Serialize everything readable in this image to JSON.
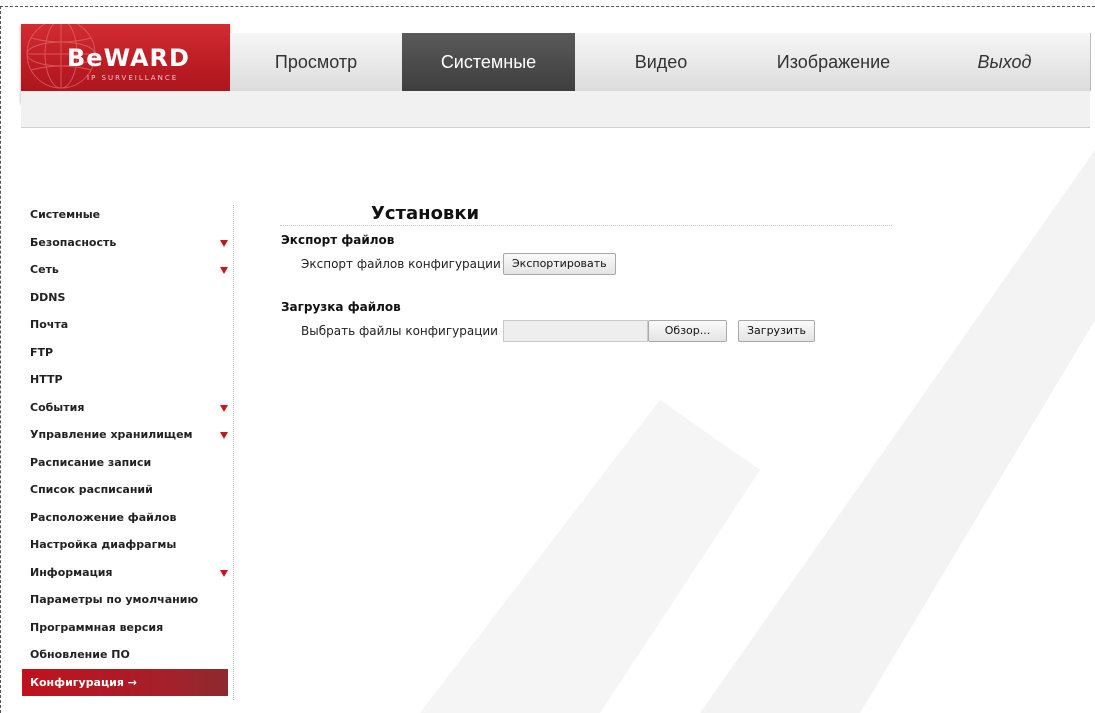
{
  "header": {
    "logo_text": "BeWARD",
    "logo_subtitle": "IP SURVEILLANCE",
    "tabs": [
      {
        "label": "Просмотр",
        "active": false,
        "italic": false
      },
      {
        "label": "Системные",
        "active": true,
        "italic": false
      },
      {
        "label": "Видео",
        "active": false,
        "italic": false
      },
      {
        "label": "Изображение",
        "active": false,
        "italic": false
      },
      {
        "label": "Выход",
        "active": false,
        "italic": true
      }
    ]
  },
  "sidebar": {
    "items": [
      {
        "label": "Системные",
        "has_submenu": false,
        "active": false
      },
      {
        "label": "Безопасность",
        "has_submenu": true,
        "active": false
      },
      {
        "label": "Сеть",
        "has_submenu": true,
        "active": false
      },
      {
        "label": "DDNS",
        "has_submenu": false,
        "active": false
      },
      {
        "label": "Почта",
        "has_submenu": false,
        "active": false
      },
      {
        "label": "FTP",
        "has_submenu": false,
        "active": false
      },
      {
        "label": "HTTP",
        "has_submenu": false,
        "active": false
      },
      {
        "label": "События",
        "has_submenu": true,
        "active": false
      },
      {
        "label": "Управление хранилищем",
        "has_submenu": true,
        "active": false
      },
      {
        "label": "Расписание записи",
        "has_submenu": false,
        "active": false
      },
      {
        "label": "Список расписаний",
        "has_submenu": false,
        "active": false
      },
      {
        "label": "Расположение файлов",
        "has_submenu": false,
        "active": false
      },
      {
        "label": "Настройка диафрагмы",
        "has_submenu": false,
        "active": false
      },
      {
        "label": "Информация",
        "has_submenu": true,
        "active": false
      },
      {
        "label": "Параметры по умолчанию",
        "has_submenu": false,
        "active": false
      },
      {
        "label": "Программная версия",
        "has_submenu": false,
        "active": false
      },
      {
        "label": "Обновление ПО",
        "has_submenu": false,
        "active": false
      },
      {
        "label": "Конфигурация →",
        "has_submenu": false,
        "active": true
      }
    ]
  },
  "main": {
    "title": "Установки",
    "export": {
      "section_title": "Экспорт файлов",
      "row_label": "Экспорт файлов конфигурации",
      "button_label": "Экспортировать"
    },
    "upload": {
      "section_title": "Загрузка файлов",
      "row_label": "Выбрать файлы конфигурации",
      "file_value": "",
      "browse_label": "Обзор...",
      "upload_label": "Загрузить"
    }
  },
  "colors": {
    "brand_red": "#c0121d",
    "active_tab": "#4a4a4a",
    "arrow_red": "#c8161f"
  }
}
